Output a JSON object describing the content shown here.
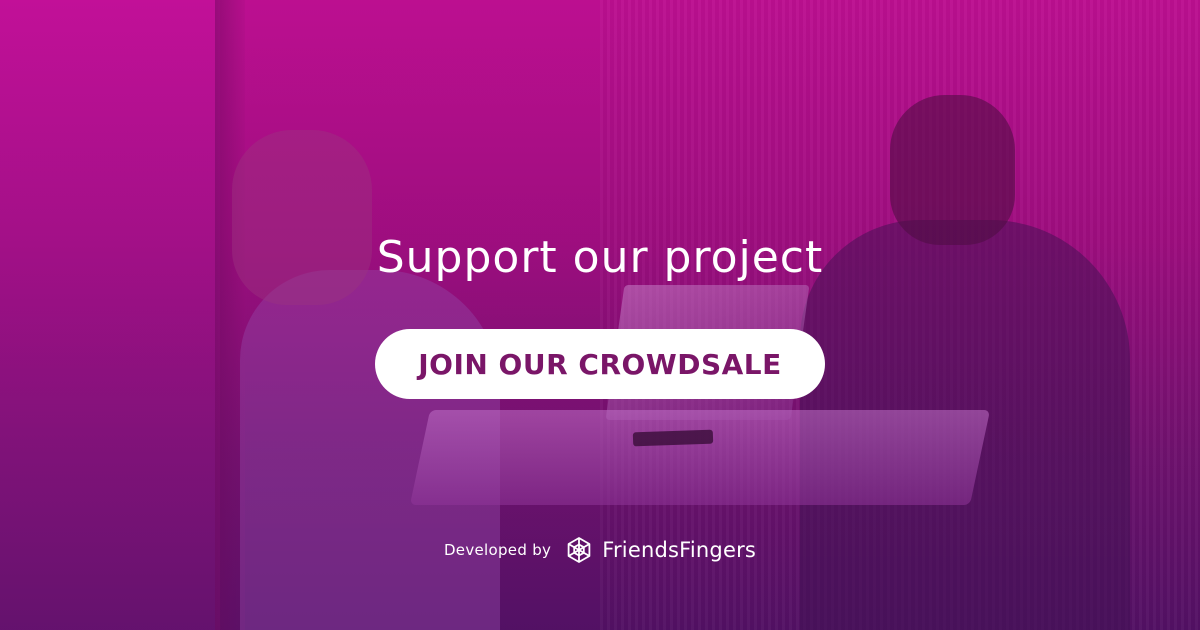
{
  "hero": {
    "headline": "Support our project",
    "cta_label": "JOIN OUR CROWDSALE"
  },
  "footer": {
    "developed_by": "Developed by",
    "brand_name": "FriendsFingers",
    "brand_icon": "friendsfingers-logo-icon"
  },
  "colors": {
    "overlay": "#a0107f",
    "cta_background": "#ffffff",
    "cta_text": "#7a1668",
    "text": "#ffffff"
  }
}
